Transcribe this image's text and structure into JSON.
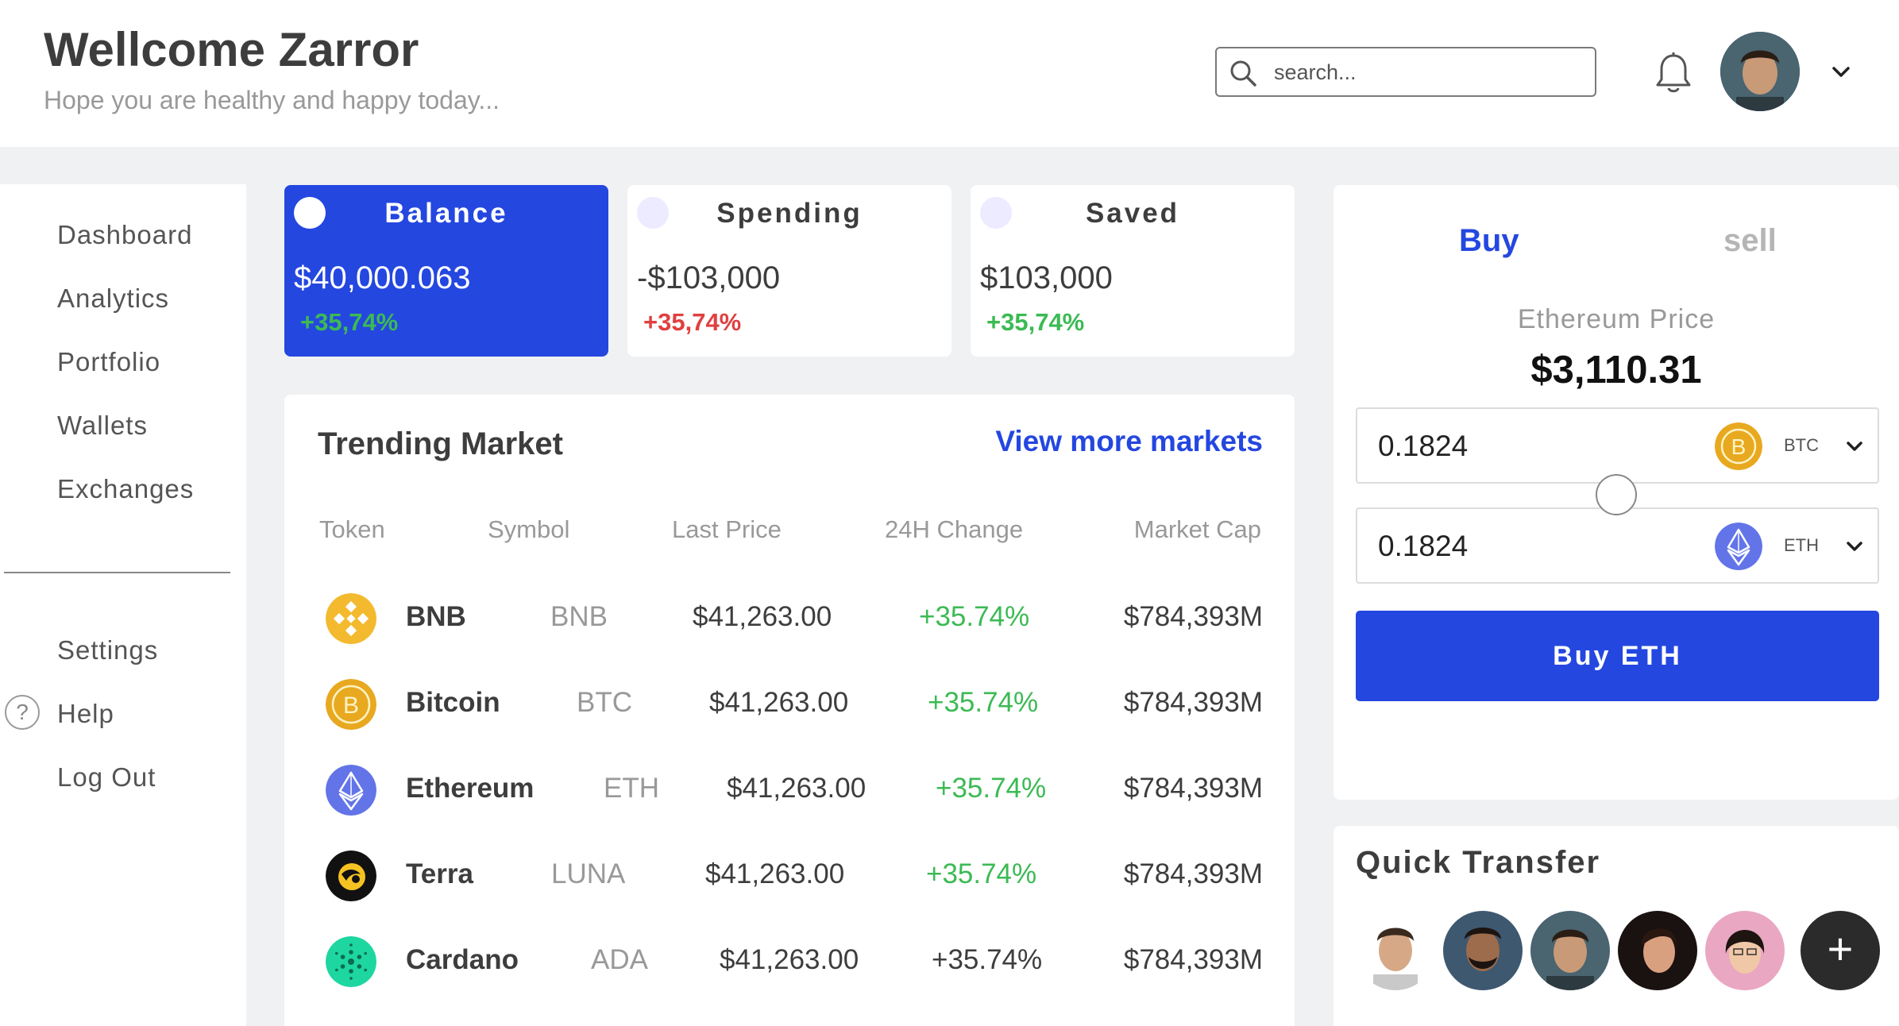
{
  "header": {
    "title": "Wellcome Zarror",
    "subtitle": "Hope you are healthy and happy today...",
    "search_placeholder": "search..."
  },
  "sidebar": {
    "items": [
      "Dashboard",
      "Analytics",
      "Portfolio",
      "Wallets",
      "Exchanges"
    ],
    "bottom_items": [
      "Settings",
      "Help",
      "Log Out"
    ],
    "help_glyph": "?"
  },
  "cards": [
    {
      "label": "Balance",
      "value": "$40,000.063",
      "change": "+35,74%",
      "change_color": "#3cba54"
    },
    {
      "label": "Spending",
      "value": "-$103,000",
      "change": "+35,74%",
      "change_color": "#e04040"
    },
    {
      "label": "Saved",
      "value": "$103,000",
      "change": "+35,74%",
      "change_color": "#3cba54"
    }
  ],
  "market": {
    "title": "Trending Market",
    "link": "View more markets",
    "columns": [
      "Token",
      "Symbol",
      "Last Price",
      "24H Change",
      "Market Cap"
    ],
    "rows": [
      {
        "icon": "bnb-icon",
        "name": "BNB",
        "symbol": "BNB",
        "price": "$41,263.00",
        "change": "+35.74%",
        "cap": "$784,393M"
      },
      {
        "icon": "bitcoin-icon",
        "name": "Bitcoin",
        "symbol": "BTC",
        "price": "$41,263.00",
        "change": "+35.74%",
        "cap": "$784,393M"
      },
      {
        "icon": "ethereum-icon",
        "name": "Ethereum",
        "symbol": "ETH",
        "price": "$41,263.00",
        "change": "+35.74%",
        "cap": "$784,393M"
      },
      {
        "icon": "terra-icon",
        "name": "Terra",
        "symbol": "LUNA",
        "price": "$41,263.00",
        "change": "+35.74%",
        "cap": "$784,393M"
      },
      {
        "icon": "cardano-icon",
        "name": "Cardano",
        "symbol": "ADA",
        "price": "$41,263.00",
        "change": "+35.74%",
        "cap": "$784,393M"
      }
    ]
  },
  "trade": {
    "tab_buy": "Buy",
    "tab_sell": "sell",
    "price_label": "Ethereum Price",
    "price": "$3,110.31",
    "from_amount": "0.1824",
    "from_symbol": "BTC",
    "to_amount": "0.1824",
    "to_symbol": "ETH",
    "button": "Buy ETH"
  },
  "quick": {
    "title": "Quick Transfer",
    "add_glyph": "+"
  },
  "colors": {
    "accent": "#2447e0",
    "positive": "#3cba54",
    "negative": "#e04040",
    "bnb": "#f3ba2f",
    "bitcoin": "#e8a920",
    "ethereum": "#6274e8",
    "terra": "#111111",
    "cardano": "#1ed6a0"
  }
}
